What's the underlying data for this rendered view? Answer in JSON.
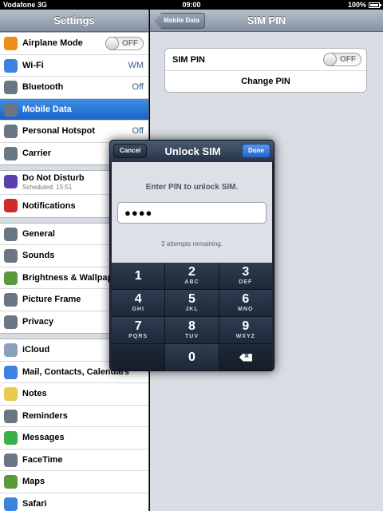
{
  "status": {
    "carrier": "Vodafone 3G",
    "time": "09:00",
    "battery": "100%"
  },
  "left": {
    "title": "Settings",
    "groups": [
      [
        {
          "label": "Airplane Mode",
          "toggle": "OFF",
          "icon": "airplane-icon",
          "color": "#f08c1c"
        },
        {
          "label": "Wi-Fi",
          "value": "WM",
          "icon": "wifi-icon",
          "color": "#3c83e0"
        },
        {
          "label": "Bluetooth",
          "value": "Off",
          "icon": "bluetooth-icon",
          "color": "#6b7685"
        },
        {
          "label": "Mobile Data",
          "selected": true,
          "icon": "antenna-icon",
          "color": "#6b7685"
        },
        {
          "label": "Personal Hotspot",
          "value": "Off",
          "icon": "hotspot-icon",
          "color": "#6b7685"
        },
        {
          "label": "Carrier",
          "icon": "phone-icon",
          "color": "#6b7685"
        }
      ],
      [
        {
          "label": "Do Not Disturb",
          "sub": "Scheduled: 15:51",
          "icon": "moon-icon",
          "color": "#5b3fb0"
        },
        {
          "label": "Notifications",
          "icon": "notifications-icon",
          "color": "#d02a2a"
        }
      ],
      [
        {
          "label": "General",
          "icon": "gear-icon",
          "color": "#6b7685"
        },
        {
          "label": "Sounds",
          "icon": "speaker-icon",
          "color": "#6b7685"
        },
        {
          "label": "Brightness & Wallpaper",
          "icon": "flower-icon",
          "color": "#5a9a3a"
        },
        {
          "label": "Picture Frame",
          "icon": "picture-icon",
          "color": "#6b7685"
        },
        {
          "label": "Privacy",
          "icon": "hand-icon",
          "color": "#6b7685"
        }
      ],
      [
        {
          "label": "iCloud",
          "icon": "cloud-icon",
          "color": "#8aa0bb"
        },
        {
          "label": "Mail, Contacts, Calendars",
          "icon": "mail-icon",
          "color": "#3c83e0"
        },
        {
          "label": "Notes",
          "icon": "notes-icon",
          "color": "#e8c94c"
        },
        {
          "label": "Reminders",
          "icon": "reminders-icon",
          "color": "#6b7685"
        },
        {
          "label": "Messages",
          "icon": "messages-icon",
          "color": "#3ab04a"
        },
        {
          "label": "FaceTime",
          "icon": "facetime-icon",
          "color": "#6b7685"
        },
        {
          "label": "Maps",
          "icon": "maps-icon",
          "color": "#5a9a3a"
        },
        {
          "label": "Safari",
          "icon": "compass-icon",
          "color": "#3c83e0"
        }
      ]
    ]
  },
  "right": {
    "back": "Mobile Data",
    "title": "SIM PIN",
    "sim_pin_label": "SIM PIN",
    "sim_pin_toggle": "OFF",
    "change_pin": "Change PIN"
  },
  "modal": {
    "title": "Unlock SIM",
    "cancel": "Cancel",
    "done": "Done",
    "prompt": "Enter PIN to unlock SIM.",
    "pin_value": "●●●●",
    "attempts": "3 attempts remaining.",
    "keys": [
      {
        "num": "1",
        "letters": ""
      },
      {
        "num": "2",
        "letters": "ABC"
      },
      {
        "num": "3",
        "letters": "DEF"
      },
      {
        "num": "4",
        "letters": "GHI"
      },
      {
        "num": "5",
        "letters": "JKL"
      },
      {
        "num": "6",
        "letters": "MNO"
      },
      {
        "num": "7",
        "letters": "PQRS"
      },
      {
        "num": "8",
        "letters": "TUV"
      },
      {
        "num": "9",
        "letters": "WXYZ"
      },
      {
        "num": "",
        "letters": ""
      },
      {
        "num": "0",
        "letters": ""
      },
      {
        "num": "",
        "letters": "",
        "delete": true
      }
    ]
  }
}
